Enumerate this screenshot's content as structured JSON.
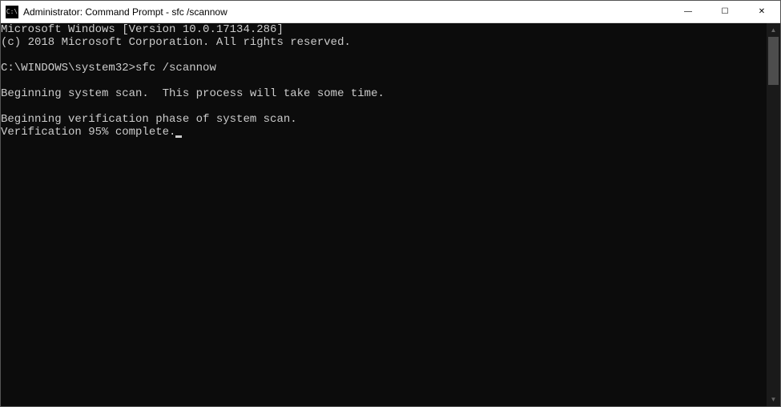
{
  "titlebar": {
    "title": "Administrator: Command Prompt - sfc  /scannow",
    "icon_label": "C:\\"
  },
  "window_controls": {
    "minimize": "—",
    "maximize": "☐",
    "close": "✕"
  },
  "terminal": {
    "lines": [
      "Microsoft Windows [Version 10.0.17134.286]",
      "(c) 2018 Microsoft Corporation. All rights reserved.",
      "",
      "C:\\WINDOWS\\system32>sfc /scannow",
      "",
      "Beginning system scan.  This process will take some time.",
      "",
      "Beginning verification phase of system scan.",
      "Verification 95% complete."
    ]
  },
  "scrollbar": {
    "up": "▲",
    "down": "▼"
  }
}
